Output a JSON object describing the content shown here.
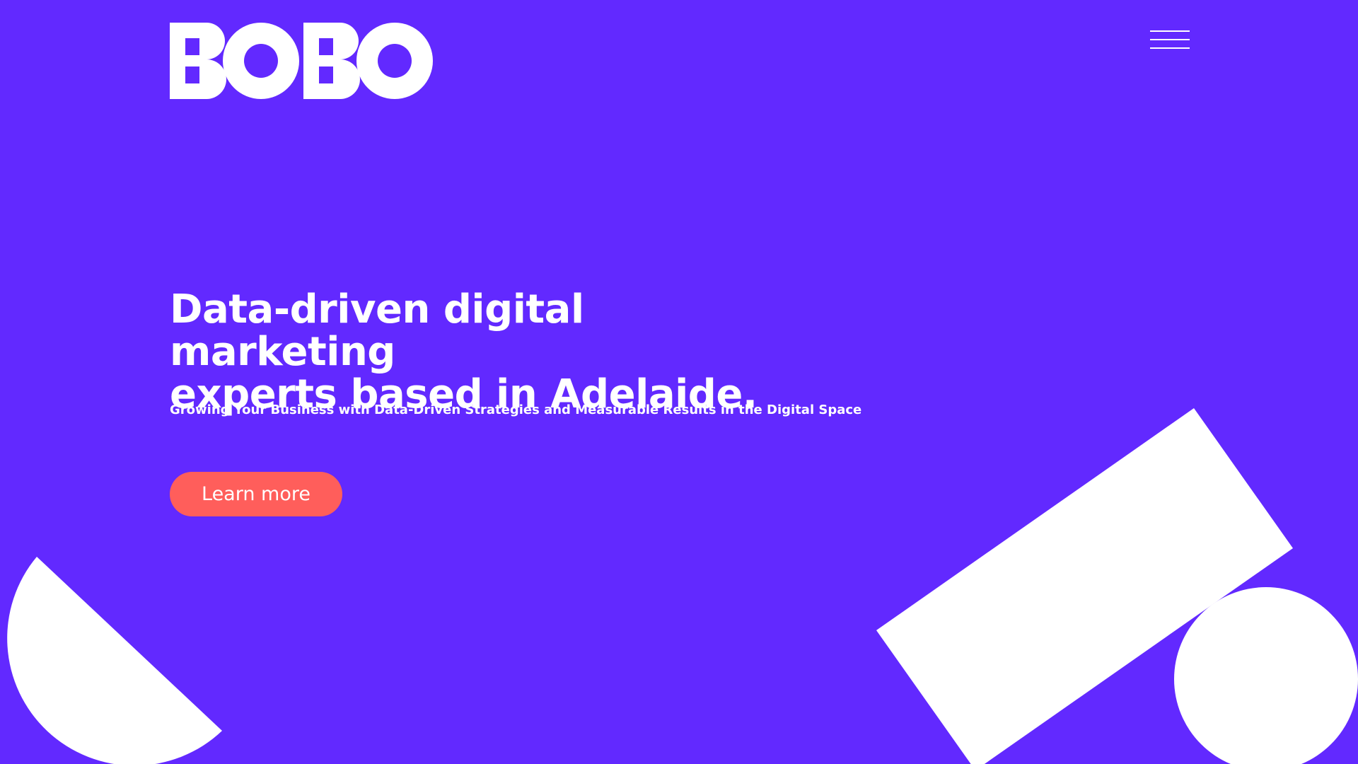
{
  "brand": {
    "logo_text": "BOBO",
    "background_color": "#6229FF",
    "accent_color": "#FF5E5B",
    "shape_color": "#FFFFFF"
  },
  "header": {
    "menu_icon": "hamburger-menu-icon"
  },
  "hero": {
    "title_line1": "Data-driven digital marketing",
    "title_line2": "experts based in Adelaide.",
    "subtitle": "Growing Your Business with Data-Driven Strategies and Measurable Results in the Digital Space",
    "cta_label": "Learn more"
  },
  "decorations": {
    "shapes": [
      "half-circle",
      "rotated-rectangle",
      "circle"
    ]
  }
}
